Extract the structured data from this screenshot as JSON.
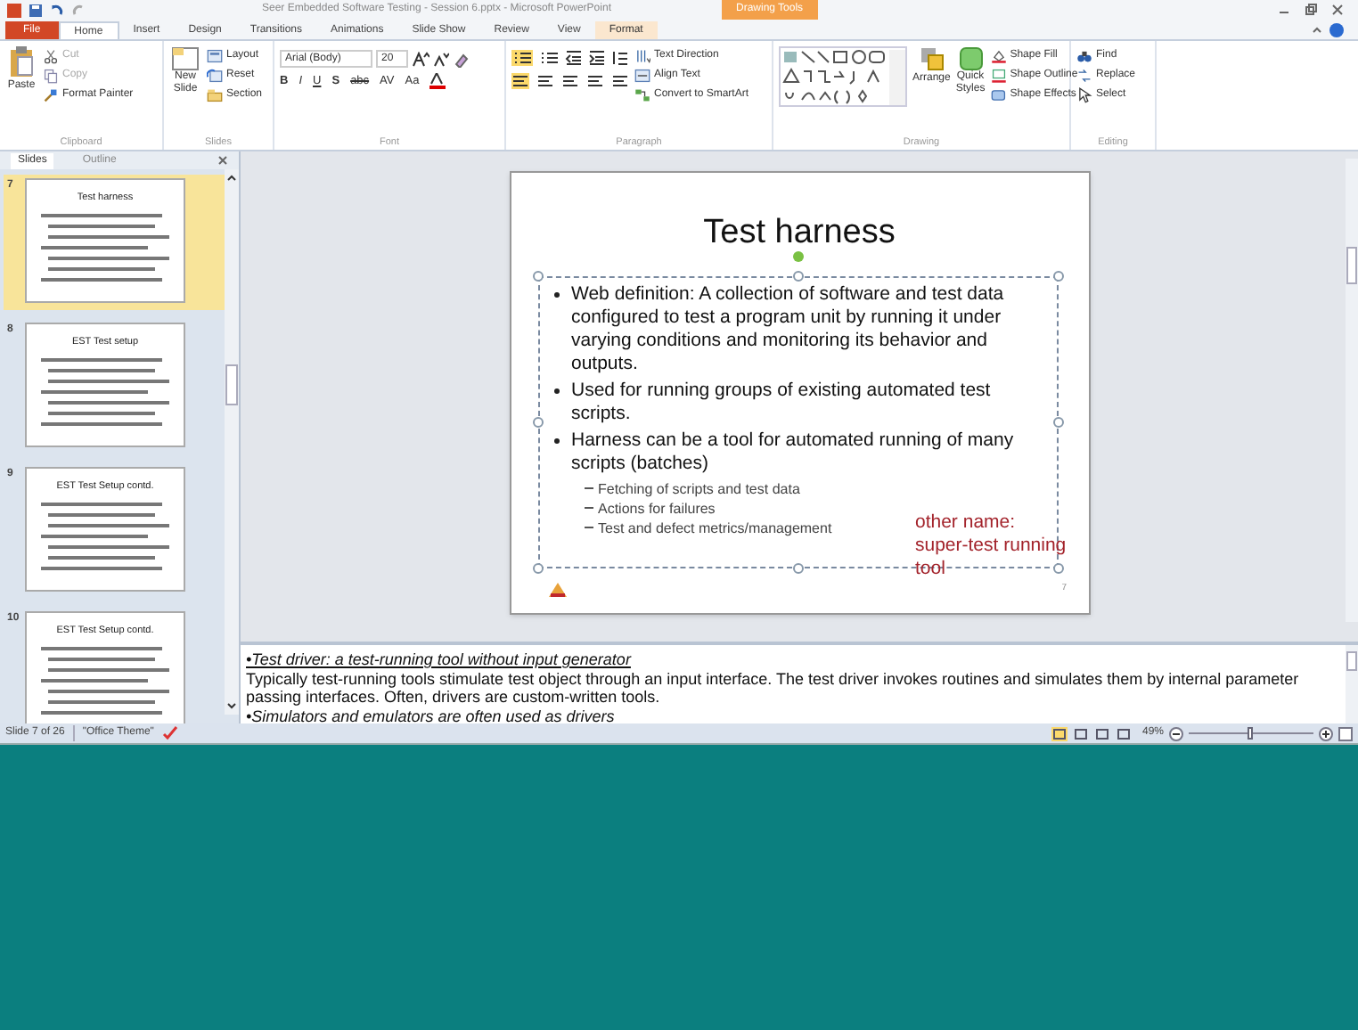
{
  "window": {
    "title": "Seer Embedded Software Testing - Session 6.pptx - Microsoft PowerPoint",
    "contextual_tab": "Drawing Tools"
  },
  "tabs": [
    {
      "label": "File",
      "kind": "file",
      "selected": false
    },
    {
      "label": "Home",
      "kind": "tab",
      "selected": true
    },
    {
      "label": "Insert",
      "kind": "tab",
      "selected": false
    },
    {
      "label": "Design",
      "kind": "tab",
      "selected": false
    },
    {
      "label": "Transitions",
      "kind": "tab",
      "selected": false
    },
    {
      "label": "Animations",
      "kind": "tab",
      "selected": false
    },
    {
      "label": "Slide Show",
      "kind": "tab",
      "selected": false
    },
    {
      "label": "Review",
      "kind": "tab",
      "selected": false
    },
    {
      "label": "View",
      "kind": "tab",
      "selected": false
    },
    {
      "label": "Format",
      "kind": "contextual",
      "selected": false
    }
  ],
  "ribbon": {
    "clipboard": {
      "label": "Clipboard",
      "paste": "Paste",
      "items": [
        {
          "label": "Cut",
          "disabled": true
        },
        {
          "label": "Copy",
          "disabled": true
        },
        {
          "label": "Format Painter",
          "disabled": false
        }
      ]
    },
    "slides": {
      "label": "Slides",
      "new_slide": "New Slide",
      "items": [
        {
          "label": "Layout"
        },
        {
          "label": "Reset"
        },
        {
          "label": "Section"
        }
      ]
    },
    "font": {
      "label": "Font",
      "font_name": "Arial (Body)",
      "font_size": "20",
      "buttons": [
        "B",
        "I",
        "U",
        "S",
        "abc",
        "AV",
        "Aa"
      ]
    },
    "paragraph": {
      "label": "Paragraph",
      "items": [
        {
          "label": "Text Direction"
        },
        {
          "label": "Align Text"
        },
        {
          "label": "Convert to SmartArt"
        }
      ]
    },
    "drawing": {
      "label": "Drawing",
      "arrange": "Arrange",
      "quick_styles": "Quick Styles",
      "items": [
        {
          "label": "Shape Fill"
        },
        {
          "label": "Shape Outline"
        },
        {
          "label": "Shape Effects"
        }
      ]
    },
    "editing": {
      "label": "Editing",
      "items": [
        {
          "label": "Find"
        },
        {
          "label": "Replace"
        },
        {
          "label": "Select"
        }
      ]
    }
  },
  "panel": {
    "tabs": [
      {
        "label": "Slides",
        "selected": true
      },
      {
        "label": "Outline",
        "selected": false
      }
    ],
    "thumbnails": [
      {
        "number": "7",
        "title": "Test harness",
        "selected": true
      },
      {
        "number": "8",
        "title": "EST Test setup",
        "selected": false
      },
      {
        "number": "9",
        "title": "EST Test Setup contd.",
        "selected": false
      },
      {
        "number": "10",
        "title": "EST Test Setup contd.",
        "selected": false
      }
    ]
  },
  "slide": {
    "title": "Test harness",
    "page_number": "7",
    "bullets": [
      {
        "text": "Web definition: A collection of software and test data configured to test a program unit by running it under varying conditions and monitoring its behavior and outputs."
      },
      {
        "text": "Used for running groups of existing automated test scripts."
      },
      {
        "text": "Harness can be a tool for automated running of many scripts (batches)",
        "children": [
          {
            "text": "Fetching of scripts and test data"
          },
          {
            "text": "Actions for failures"
          },
          {
            "text": "Test and defect metrics/management"
          }
        ]
      }
    ],
    "annotation": [
      "other name:",
      "super-test running",
      "tool"
    ]
  },
  "notes": [
    {
      "kind": "heading",
      "text": "•Test driver: a test-running tool without input generator"
    },
    {
      "kind": "body",
      "text": "Typically test-running tools stimulate test object through an input interface. The test driver invokes routines and simulates them by internal parameter passing interfaces. Often, drivers are custom-written tools."
    },
    {
      "kind": "heading",
      "text": "•Simulators and emulators are often used as drivers"
    }
  ],
  "status_bar": {
    "slide": "Slide 7 of 26",
    "theme": "\"Office Theme\"",
    "zoom": "49%",
    "zoom_level": {
      "level": 0.5
    }
  }
}
